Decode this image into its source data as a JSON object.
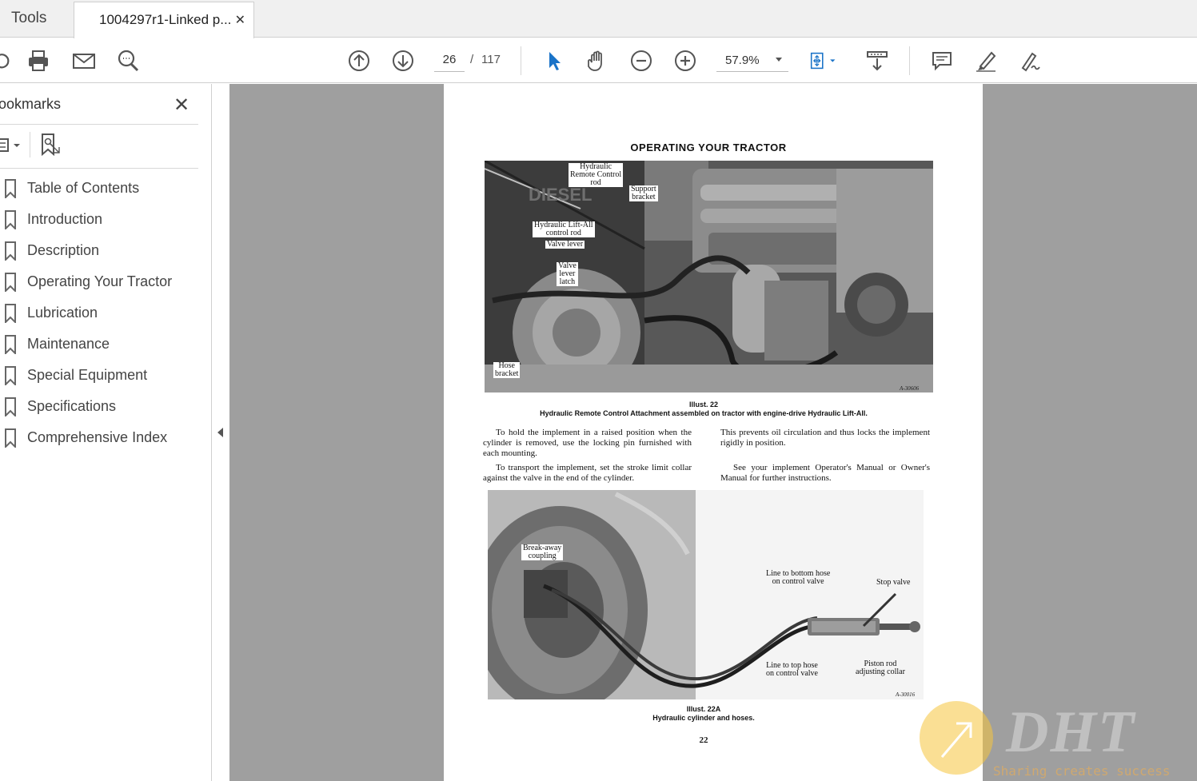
{
  "tabs": {
    "tools_label": "Tools",
    "document_title": "1004297r1-Linked p...",
    "close_glyph": "✕"
  },
  "toolbar": {
    "current_page": "26",
    "page_separator": "/",
    "total_pages": "117",
    "zoom": "57.9%",
    "icons": [
      "share-icon",
      "print-icon",
      "email-icon",
      "search-icon",
      "page-up-icon",
      "page-down-icon",
      "select-tool-icon",
      "hand-tool-icon",
      "zoom-out-icon",
      "zoom-in-icon",
      "fit-page-icon",
      "scroll-mode-icon",
      "comment-icon",
      "highlight-icon",
      "sign-icon"
    ]
  },
  "sidebar": {
    "title": "ookmarks",
    "close_glyph": "✕",
    "bookmarks": [
      {
        "label": "Table of Contents"
      },
      {
        "label": "Introduction"
      },
      {
        "label": "Description"
      },
      {
        "label": "Operating Your Tractor"
      },
      {
        "label": "Lubrication"
      },
      {
        "label": "Maintenance"
      },
      {
        "label": "Special Equipment"
      },
      {
        "label": "Specifications"
      },
      {
        "label": "Comprehensive Index"
      }
    ]
  },
  "document": {
    "heading": "OPERATING YOUR TRACTOR",
    "illus1": {
      "labels": {
        "remote_rod": "Hydraulic\nRemote Control\nrod",
        "support_bracket": "Support\nbracket",
        "liftall_rod": "Hydraulic Lift-All\ncontrol rod",
        "valve_lever": "Valve lever",
        "valve_latch": "Valve\nlever\nlatch",
        "hose_bracket": "Hose\nbracket",
        "code": "A-30606"
      },
      "number": "Illust. 22",
      "caption": "Hydraulic Remote Control Attachment assembled on tractor with engine-drive Hydraulic Lift-All."
    },
    "paragraphs_left": [
      "To hold the implement in a raised position when the cylinder is removed, use the locking pin furnished with each mounting.",
      "To transport the implement, set the stroke limit collar against the valve in the end of the cylinder."
    ],
    "paragraphs_right": [
      "This prevents oil circulation and thus locks the implement rigidly in position.",
      "See your implement Operator's Manual or Owner's Manual for further instructions."
    ],
    "illus2": {
      "labels": {
        "breakaway": "Break-away\ncoupling",
        "bottom_hose": "Line to bottom hose\non control valve",
        "stop_valve": "Stop valve",
        "top_hose": "Line to top hose\non control valve",
        "piston_collar": "Piston rod\nadjusting collar",
        "code": "A-30016"
      },
      "number": "Illust. 22A",
      "caption": "Hydraulic cylinder and hoses."
    },
    "page_number": "22"
  },
  "watermark": {
    "brand": "DHT",
    "tagline": "Sharing creates success",
    "circle_color": "#f6c43c"
  }
}
